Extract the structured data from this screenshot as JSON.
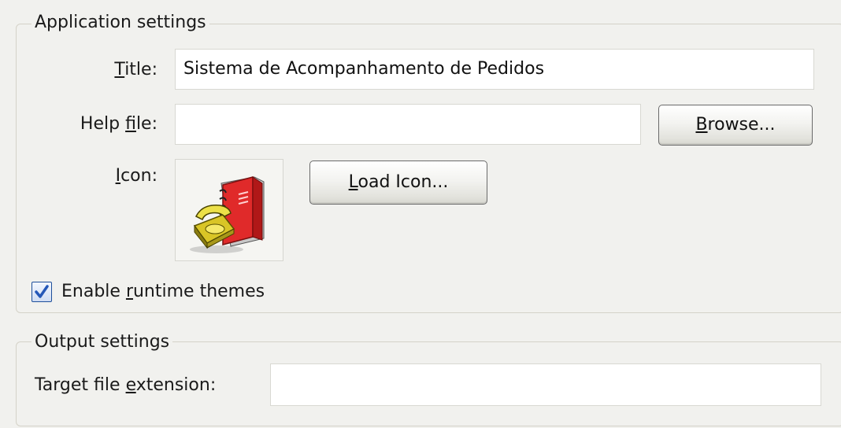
{
  "application_settings": {
    "legend": "Application settings",
    "title": {
      "label_prefix": "",
      "label_mnemonic": "T",
      "label_suffix": "itle:",
      "value": "Sistema de Acompanhamento de Pedidos"
    },
    "help_file": {
      "label_prefix": "Help ",
      "label_mnemonic": "f",
      "label_suffix": "ile:",
      "value": "",
      "browse_button": {
        "prefix": "",
        "mnemonic": "B",
        "suffix": "rowse..."
      }
    },
    "icon": {
      "label_prefix": "",
      "label_mnemonic": "I",
      "label_suffix": "con:",
      "image": "phone-and-book-icon",
      "load_button": {
        "prefix": "",
        "mnemonic": "L",
        "suffix": "oad Icon..."
      }
    },
    "runtime_themes": {
      "label_prefix": "Enable ",
      "label_mnemonic": "r",
      "label_suffix": "untime themes",
      "checked": true
    }
  },
  "output_settings": {
    "legend": "Output settings",
    "target_extension": {
      "label_prefix": "Target file ",
      "label_mnemonic": "e",
      "label_suffix": "xtension:",
      "value": ""
    }
  },
  "colors": {
    "background": "#f1f1ee",
    "groupbox_border": "#d4d2c8",
    "checkbox_check": "#2457b8",
    "book_red": "#e02a2a",
    "phone_yellow": "#e8d430"
  }
}
